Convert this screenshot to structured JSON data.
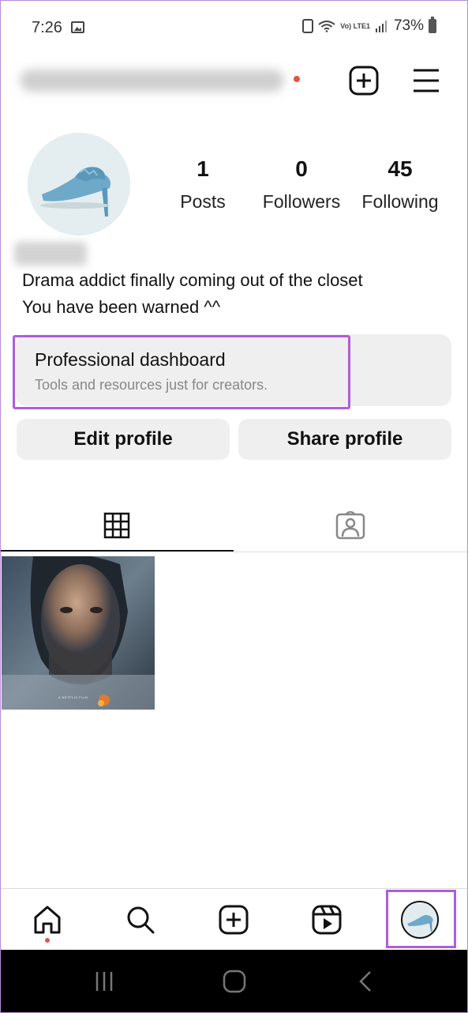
{
  "status_bar": {
    "time": "7:26",
    "network": "Vo) LTE1",
    "battery": "73%"
  },
  "header": {
    "new_post_icon": "plus-square-icon",
    "menu_icon": "hamburger-menu-icon"
  },
  "profile": {
    "stats": [
      {
        "value": "1",
        "label": "Posts"
      },
      {
        "value": "0",
        "label": "Followers"
      },
      {
        "value": "45",
        "label": "Following"
      }
    ],
    "bio_lines": [
      "Drama addict finally coming out of the closet",
      "You have been warned ^^"
    ]
  },
  "dashboard": {
    "title": "Professional dashboard",
    "subtitle": "Tools and resources just for creators."
  },
  "actions": {
    "edit_label": "Edit profile",
    "share_label": "Share profile"
  },
  "tabs": [
    {
      "icon": "grid-icon",
      "active": true
    },
    {
      "icon": "tagged-person-icon",
      "active": false
    }
  ],
  "posts": [
    {
      "caption": "A NETFLIX FILM"
    }
  ],
  "bottom_nav": [
    "home-icon",
    "search-icon",
    "create-icon",
    "reels-icon",
    "profile-avatar"
  ],
  "colors": {
    "highlight": "#b05cdc",
    "notification_dot": "#e0544a",
    "card_bg": "#efefef"
  }
}
